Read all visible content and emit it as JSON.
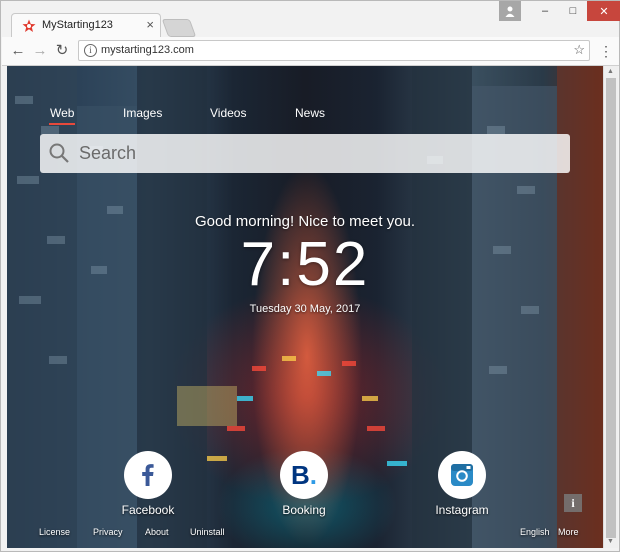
{
  "browser": {
    "tab_title": "MyStarting123",
    "tab_close": "×",
    "url": "mystarting123.com",
    "back": "←",
    "forward": "→",
    "reload": "↻",
    "star": "☆",
    "menu": "⋮",
    "win_min": "–",
    "win_max": "□",
    "win_close": "✕"
  },
  "search": {
    "tabs": [
      {
        "label": "Web",
        "active": true
      },
      {
        "label": "Images",
        "active": false
      },
      {
        "label": "Videos",
        "active": false
      },
      {
        "label": "News",
        "active": false
      }
    ],
    "placeholder": "Search"
  },
  "greeting": "Good morning! Nice to meet you.",
  "clock": "7:52",
  "date": "Tuesday 30 May, 2017",
  "quick_links": [
    {
      "label": "Facebook",
      "icon": "facebook-icon",
      "color": "#3b5998"
    },
    {
      "label": "Booking",
      "icon": "booking-icon",
      "color": "#003580"
    },
    {
      "label": "Instagram",
      "icon": "instagram-icon",
      "color": "#2a8ac6"
    }
  ],
  "footer": {
    "left": [
      "License",
      "Privacy",
      "About",
      "Uninstall"
    ],
    "language": "English",
    "more": "More",
    "info": "i"
  },
  "colors": {
    "accent": "#e8493b",
    "close_button": "#c7463d"
  }
}
